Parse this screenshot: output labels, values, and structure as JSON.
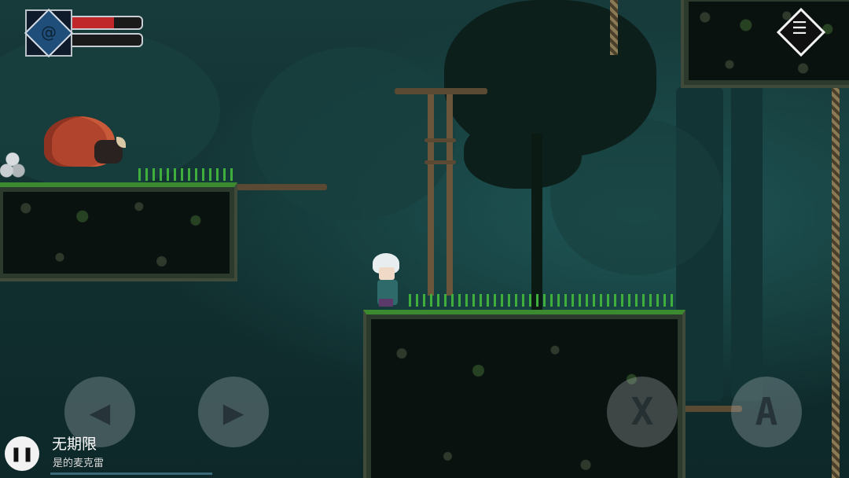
{
  "hud": {
    "emblem_icon": "swirl-emblem-icon",
    "health_level": 0.62,
    "energy_level": 0.0,
    "menu_icon": "hamburger-menu-icon"
  },
  "controls": {
    "left_icon": "arrow-left-icon",
    "right_icon": "arrow-right-icon",
    "x_label": "X",
    "a_label": "A"
  },
  "music": {
    "pause_icon": "pause-icon",
    "title": "无期限",
    "artist": "是的麦克雷",
    "progress": 0.0
  },
  "colors": {
    "health_red": "#c0272a",
    "grass_green": "#3fae3c",
    "forest_bg": "#123131"
  }
}
